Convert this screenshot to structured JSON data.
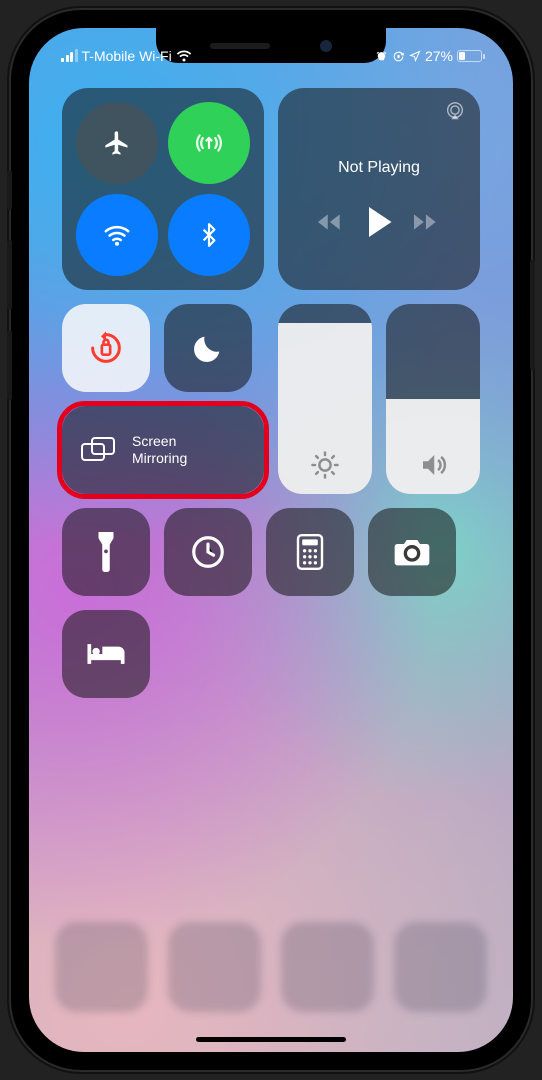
{
  "status": {
    "carrier": "T-Mobile Wi-Fi",
    "battery_pct": "27%",
    "battery_fill_pct": 27,
    "signal_bars": 3,
    "signal_bars_total": 4
  },
  "connectivity": {
    "airplane": {
      "enabled": false,
      "icon": "airplane-icon"
    },
    "cellular": {
      "enabled": true,
      "icon": "cellular-icon"
    },
    "wifi": {
      "enabled": true,
      "icon": "wifi-icon"
    },
    "bluetooth": {
      "enabled": true,
      "icon": "bluetooth-icon"
    }
  },
  "music": {
    "title": "Not Playing",
    "airplay_icon": "airplay-icon",
    "controls": [
      "back-icon",
      "play-icon",
      "forward-icon"
    ]
  },
  "row2": {
    "rotation_lock": {
      "active": true,
      "icon": "rotation-lock-icon",
      "color": "#ff3b30"
    },
    "do_not_disturb": {
      "active": false,
      "icon": "moon-icon"
    },
    "screen_mirroring": {
      "icon": "screen-mirroring-icon",
      "label": "Screen\nMirroring",
      "highlighted": true
    }
  },
  "sliders": {
    "brightness": {
      "level_pct": 90,
      "icon": "brightness-icon"
    },
    "volume": {
      "level_pct": 50,
      "icon": "volume-icon"
    }
  },
  "buttons": {
    "flashlight": "flashlight-icon",
    "timer": "timer-icon",
    "calculator": "calculator-icon",
    "camera": "camera-icon",
    "sleep": "bed-icon"
  },
  "colors": {
    "highlight": "#e3001c",
    "green": "#30d158",
    "blue": "#0a7cff"
  }
}
